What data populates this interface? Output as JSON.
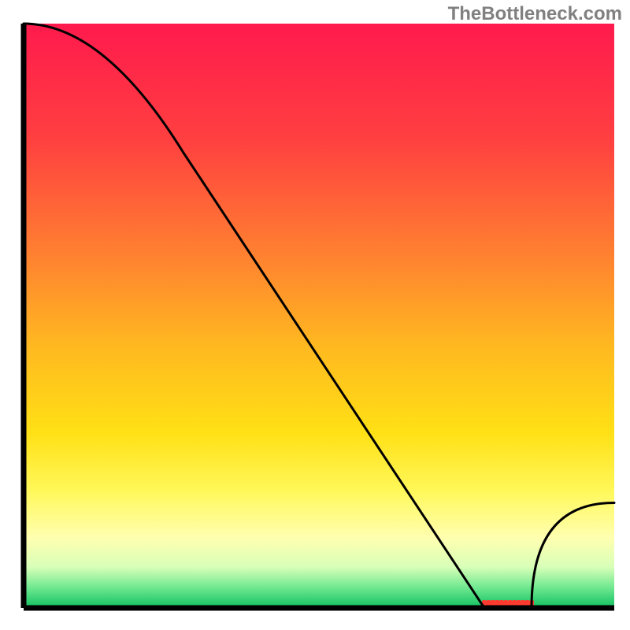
{
  "watermark": "TheBottleneck.com",
  "chart_data": {
    "type": "line",
    "title": "",
    "xlabel": "",
    "ylabel": "",
    "xlim": [
      0,
      100
    ],
    "ylim": [
      0,
      100
    ],
    "x": [
      0,
      27,
      78,
      86,
      100
    ],
    "values": [
      100,
      78,
      0,
      0,
      18
    ],
    "notes": "Single black curve over a vertical red→yellow→green gradient. Starts at top-left corner, gentle downward slope to ~27% width, then near-straight steep descent to the bottom at ~78% width, flat along the bottom to ~86% width (segment highlighted by a small red region), then rises to ~18% height at the right edge. No axis ticks, no legend.",
    "gradient_stops": [
      {
        "offset": 0.0,
        "color": "#ff1a4d"
      },
      {
        "offset": 0.2,
        "color": "#ff4040"
      },
      {
        "offset": 0.4,
        "color": "#ff8230"
      },
      {
        "offset": 0.55,
        "color": "#ffb820"
      },
      {
        "offset": 0.7,
        "color": "#ffe015"
      },
      {
        "offset": 0.8,
        "color": "#fff85a"
      },
      {
        "offset": 0.88,
        "color": "#ffffb0"
      },
      {
        "offset": 0.93,
        "color": "#d8ffb8"
      },
      {
        "offset": 0.965,
        "color": "#70e890"
      },
      {
        "offset": 1.0,
        "color": "#10c060"
      }
    ],
    "minimum_marker": {
      "x_start": 78,
      "x_end": 86,
      "color": "#ff3b30"
    },
    "axis_color": "#000000",
    "line_color": "#000000"
  }
}
